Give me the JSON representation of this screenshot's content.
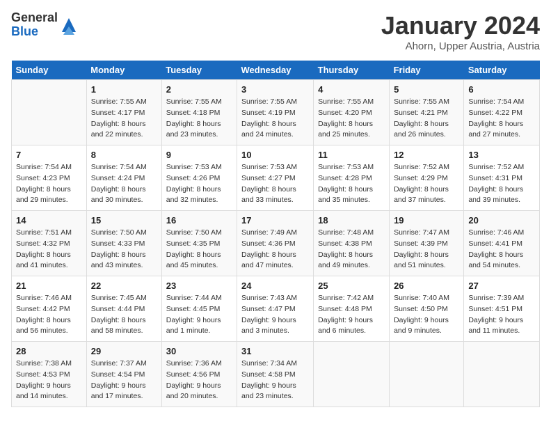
{
  "header": {
    "logo_general": "General",
    "logo_blue": "Blue",
    "title": "January 2024",
    "subtitle": "Ahorn, Upper Austria, Austria"
  },
  "weekdays": [
    "Sunday",
    "Monday",
    "Tuesday",
    "Wednesday",
    "Thursday",
    "Friday",
    "Saturday"
  ],
  "weeks": [
    [
      {
        "num": "",
        "sunrise": "",
        "sunset": "",
        "daylight": ""
      },
      {
        "num": "1",
        "sunrise": "Sunrise: 7:55 AM",
        "sunset": "Sunset: 4:17 PM",
        "daylight": "Daylight: 8 hours and 22 minutes."
      },
      {
        "num": "2",
        "sunrise": "Sunrise: 7:55 AM",
        "sunset": "Sunset: 4:18 PM",
        "daylight": "Daylight: 8 hours and 23 minutes."
      },
      {
        "num": "3",
        "sunrise": "Sunrise: 7:55 AM",
        "sunset": "Sunset: 4:19 PM",
        "daylight": "Daylight: 8 hours and 24 minutes."
      },
      {
        "num": "4",
        "sunrise": "Sunrise: 7:55 AM",
        "sunset": "Sunset: 4:20 PM",
        "daylight": "Daylight: 8 hours and 25 minutes."
      },
      {
        "num": "5",
        "sunrise": "Sunrise: 7:55 AM",
        "sunset": "Sunset: 4:21 PM",
        "daylight": "Daylight: 8 hours and 26 minutes."
      },
      {
        "num": "6",
        "sunrise": "Sunrise: 7:54 AM",
        "sunset": "Sunset: 4:22 PM",
        "daylight": "Daylight: 8 hours and 27 minutes."
      }
    ],
    [
      {
        "num": "7",
        "sunrise": "Sunrise: 7:54 AM",
        "sunset": "Sunset: 4:23 PM",
        "daylight": "Daylight: 8 hours and 29 minutes."
      },
      {
        "num": "8",
        "sunrise": "Sunrise: 7:54 AM",
        "sunset": "Sunset: 4:24 PM",
        "daylight": "Daylight: 8 hours and 30 minutes."
      },
      {
        "num": "9",
        "sunrise": "Sunrise: 7:53 AM",
        "sunset": "Sunset: 4:26 PM",
        "daylight": "Daylight: 8 hours and 32 minutes."
      },
      {
        "num": "10",
        "sunrise": "Sunrise: 7:53 AM",
        "sunset": "Sunset: 4:27 PM",
        "daylight": "Daylight: 8 hours and 33 minutes."
      },
      {
        "num": "11",
        "sunrise": "Sunrise: 7:53 AM",
        "sunset": "Sunset: 4:28 PM",
        "daylight": "Daylight: 8 hours and 35 minutes."
      },
      {
        "num": "12",
        "sunrise": "Sunrise: 7:52 AM",
        "sunset": "Sunset: 4:29 PM",
        "daylight": "Daylight: 8 hours and 37 minutes."
      },
      {
        "num": "13",
        "sunrise": "Sunrise: 7:52 AM",
        "sunset": "Sunset: 4:31 PM",
        "daylight": "Daylight: 8 hours and 39 minutes."
      }
    ],
    [
      {
        "num": "14",
        "sunrise": "Sunrise: 7:51 AM",
        "sunset": "Sunset: 4:32 PM",
        "daylight": "Daylight: 8 hours and 41 minutes."
      },
      {
        "num": "15",
        "sunrise": "Sunrise: 7:50 AM",
        "sunset": "Sunset: 4:33 PM",
        "daylight": "Daylight: 8 hours and 43 minutes."
      },
      {
        "num": "16",
        "sunrise": "Sunrise: 7:50 AM",
        "sunset": "Sunset: 4:35 PM",
        "daylight": "Daylight: 8 hours and 45 minutes."
      },
      {
        "num": "17",
        "sunrise": "Sunrise: 7:49 AM",
        "sunset": "Sunset: 4:36 PM",
        "daylight": "Daylight: 8 hours and 47 minutes."
      },
      {
        "num": "18",
        "sunrise": "Sunrise: 7:48 AM",
        "sunset": "Sunset: 4:38 PM",
        "daylight": "Daylight: 8 hours and 49 minutes."
      },
      {
        "num": "19",
        "sunrise": "Sunrise: 7:47 AM",
        "sunset": "Sunset: 4:39 PM",
        "daylight": "Daylight: 8 hours and 51 minutes."
      },
      {
        "num": "20",
        "sunrise": "Sunrise: 7:46 AM",
        "sunset": "Sunset: 4:41 PM",
        "daylight": "Daylight: 8 hours and 54 minutes."
      }
    ],
    [
      {
        "num": "21",
        "sunrise": "Sunrise: 7:46 AM",
        "sunset": "Sunset: 4:42 PM",
        "daylight": "Daylight: 8 hours and 56 minutes."
      },
      {
        "num": "22",
        "sunrise": "Sunrise: 7:45 AM",
        "sunset": "Sunset: 4:44 PM",
        "daylight": "Daylight: 8 hours and 58 minutes."
      },
      {
        "num": "23",
        "sunrise": "Sunrise: 7:44 AM",
        "sunset": "Sunset: 4:45 PM",
        "daylight": "Daylight: 9 hours and 1 minute."
      },
      {
        "num": "24",
        "sunrise": "Sunrise: 7:43 AM",
        "sunset": "Sunset: 4:47 PM",
        "daylight": "Daylight: 9 hours and 3 minutes."
      },
      {
        "num": "25",
        "sunrise": "Sunrise: 7:42 AM",
        "sunset": "Sunset: 4:48 PM",
        "daylight": "Daylight: 9 hours and 6 minutes."
      },
      {
        "num": "26",
        "sunrise": "Sunrise: 7:40 AM",
        "sunset": "Sunset: 4:50 PM",
        "daylight": "Daylight: 9 hours and 9 minutes."
      },
      {
        "num": "27",
        "sunrise": "Sunrise: 7:39 AM",
        "sunset": "Sunset: 4:51 PM",
        "daylight": "Daylight: 9 hours and 11 minutes."
      }
    ],
    [
      {
        "num": "28",
        "sunrise": "Sunrise: 7:38 AM",
        "sunset": "Sunset: 4:53 PM",
        "daylight": "Daylight: 9 hours and 14 minutes."
      },
      {
        "num": "29",
        "sunrise": "Sunrise: 7:37 AM",
        "sunset": "Sunset: 4:54 PM",
        "daylight": "Daylight: 9 hours and 17 minutes."
      },
      {
        "num": "30",
        "sunrise": "Sunrise: 7:36 AM",
        "sunset": "Sunset: 4:56 PM",
        "daylight": "Daylight: 9 hours and 20 minutes."
      },
      {
        "num": "31",
        "sunrise": "Sunrise: 7:34 AM",
        "sunset": "Sunset: 4:58 PM",
        "daylight": "Daylight: 9 hours and 23 minutes."
      },
      {
        "num": "",
        "sunrise": "",
        "sunset": "",
        "daylight": ""
      },
      {
        "num": "",
        "sunrise": "",
        "sunset": "",
        "daylight": ""
      },
      {
        "num": "",
        "sunrise": "",
        "sunset": "",
        "daylight": ""
      }
    ]
  ]
}
